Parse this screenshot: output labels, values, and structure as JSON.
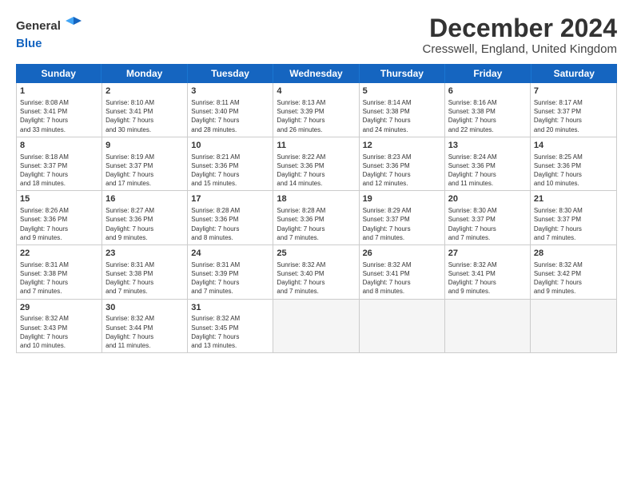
{
  "header": {
    "logo_line1": "General",
    "logo_line2": "Blue",
    "month_title": "December 2024",
    "location": "Cresswell, England, United Kingdom"
  },
  "weekdays": [
    "Sunday",
    "Monday",
    "Tuesday",
    "Wednesday",
    "Thursday",
    "Friday",
    "Saturday"
  ],
  "rows": [
    [
      {
        "day": "1",
        "lines": [
          "Sunrise: 8:08 AM",
          "Sunset: 3:41 PM",
          "Daylight: 7 hours",
          "and 33 minutes."
        ]
      },
      {
        "day": "2",
        "lines": [
          "Sunrise: 8:10 AM",
          "Sunset: 3:41 PM",
          "Daylight: 7 hours",
          "and 30 minutes."
        ]
      },
      {
        "day": "3",
        "lines": [
          "Sunrise: 8:11 AM",
          "Sunset: 3:40 PM",
          "Daylight: 7 hours",
          "and 28 minutes."
        ]
      },
      {
        "day": "4",
        "lines": [
          "Sunrise: 8:13 AM",
          "Sunset: 3:39 PM",
          "Daylight: 7 hours",
          "and 26 minutes."
        ]
      },
      {
        "day": "5",
        "lines": [
          "Sunrise: 8:14 AM",
          "Sunset: 3:38 PM",
          "Daylight: 7 hours",
          "and 24 minutes."
        ]
      },
      {
        "day": "6",
        "lines": [
          "Sunrise: 8:16 AM",
          "Sunset: 3:38 PM",
          "Daylight: 7 hours",
          "and 22 minutes."
        ]
      },
      {
        "day": "7",
        "lines": [
          "Sunrise: 8:17 AM",
          "Sunset: 3:37 PM",
          "Daylight: 7 hours",
          "and 20 minutes."
        ]
      }
    ],
    [
      {
        "day": "8",
        "lines": [
          "Sunrise: 8:18 AM",
          "Sunset: 3:37 PM",
          "Daylight: 7 hours",
          "and 18 minutes."
        ]
      },
      {
        "day": "9",
        "lines": [
          "Sunrise: 8:19 AM",
          "Sunset: 3:37 PM",
          "Daylight: 7 hours",
          "and 17 minutes."
        ]
      },
      {
        "day": "10",
        "lines": [
          "Sunrise: 8:21 AM",
          "Sunset: 3:36 PM",
          "Daylight: 7 hours",
          "and 15 minutes."
        ]
      },
      {
        "day": "11",
        "lines": [
          "Sunrise: 8:22 AM",
          "Sunset: 3:36 PM",
          "Daylight: 7 hours",
          "and 14 minutes."
        ]
      },
      {
        "day": "12",
        "lines": [
          "Sunrise: 8:23 AM",
          "Sunset: 3:36 PM",
          "Daylight: 7 hours",
          "and 12 minutes."
        ]
      },
      {
        "day": "13",
        "lines": [
          "Sunrise: 8:24 AM",
          "Sunset: 3:36 PM",
          "Daylight: 7 hours",
          "and 11 minutes."
        ]
      },
      {
        "day": "14",
        "lines": [
          "Sunrise: 8:25 AM",
          "Sunset: 3:36 PM",
          "Daylight: 7 hours",
          "and 10 minutes."
        ]
      }
    ],
    [
      {
        "day": "15",
        "lines": [
          "Sunrise: 8:26 AM",
          "Sunset: 3:36 PM",
          "Daylight: 7 hours",
          "and 9 minutes."
        ]
      },
      {
        "day": "16",
        "lines": [
          "Sunrise: 8:27 AM",
          "Sunset: 3:36 PM",
          "Daylight: 7 hours",
          "and 9 minutes."
        ]
      },
      {
        "day": "17",
        "lines": [
          "Sunrise: 8:28 AM",
          "Sunset: 3:36 PM",
          "Daylight: 7 hours",
          "and 8 minutes."
        ]
      },
      {
        "day": "18",
        "lines": [
          "Sunrise: 8:28 AM",
          "Sunset: 3:36 PM",
          "Daylight: 7 hours",
          "and 7 minutes."
        ]
      },
      {
        "day": "19",
        "lines": [
          "Sunrise: 8:29 AM",
          "Sunset: 3:37 PM",
          "Daylight: 7 hours",
          "and 7 minutes."
        ]
      },
      {
        "day": "20",
        "lines": [
          "Sunrise: 8:30 AM",
          "Sunset: 3:37 PM",
          "Daylight: 7 hours",
          "and 7 minutes."
        ]
      },
      {
        "day": "21",
        "lines": [
          "Sunrise: 8:30 AM",
          "Sunset: 3:37 PM",
          "Daylight: 7 hours",
          "and 7 minutes."
        ]
      }
    ],
    [
      {
        "day": "22",
        "lines": [
          "Sunrise: 8:31 AM",
          "Sunset: 3:38 PM",
          "Daylight: 7 hours",
          "and 7 minutes."
        ]
      },
      {
        "day": "23",
        "lines": [
          "Sunrise: 8:31 AM",
          "Sunset: 3:38 PM",
          "Daylight: 7 hours",
          "and 7 minutes."
        ]
      },
      {
        "day": "24",
        "lines": [
          "Sunrise: 8:31 AM",
          "Sunset: 3:39 PM",
          "Daylight: 7 hours",
          "and 7 minutes."
        ]
      },
      {
        "day": "25",
        "lines": [
          "Sunrise: 8:32 AM",
          "Sunset: 3:40 PM",
          "Daylight: 7 hours",
          "and 7 minutes."
        ]
      },
      {
        "day": "26",
        "lines": [
          "Sunrise: 8:32 AM",
          "Sunset: 3:41 PM",
          "Daylight: 7 hours",
          "and 8 minutes."
        ]
      },
      {
        "day": "27",
        "lines": [
          "Sunrise: 8:32 AM",
          "Sunset: 3:41 PM",
          "Daylight: 7 hours",
          "and 9 minutes."
        ]
      },
      {
        "day": "28",
        "lines": [
          "Sunrise: 8:32 AM",
          "Sunset: 3:42 PM",
          "Daylight: 7 hours",
          "and 9 minutes."
        ]
      }
    ],
    [
      {
        "day": "29",
        "lines": [
          "Sunrise: 8:32 AM",
          "Sunset: 3:43 PM",
          "Daylight: 7 hours",
          "and 10 minutes."
        ]
      },
      {
        "day": "30",
        "lines": [
          "Sunrise: 8:32 AM",
          "Sunset: 3:44 PM",
          "Daylight: 7 hours",
          "and 11 minutes."
        ]
      },
      {
        "day": "31",
        "lines": [
          "Sunrise: 8:32 AM",
          "Sunset: 3:45 PM",
          "Daylight: 7 hours",
          "and 13 minutes."
        ]
      },
      {
        "day": "",
        "lines": []
      },
      {
        "day": "",
        "lines": []
      },
      {
        "day": "",
        "lines": []
      },
      {
        "day": "",
        "lines": []
      }
    ]
  ]
}
